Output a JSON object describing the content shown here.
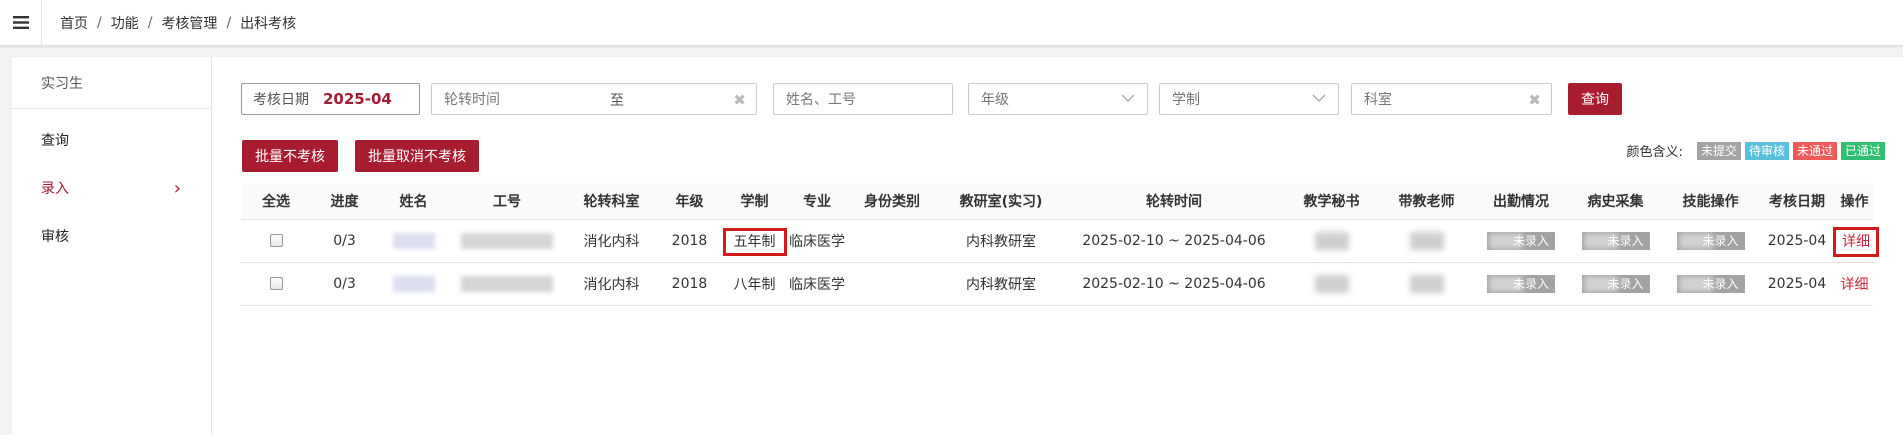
{
  "breadcrumb": [
    "首页",
    "功能",
    "考核管理",
    "出科考核"
  ],
  "sidebar": {
    "header": "实习生",
    "items": [
      {
        "label": "查询",
        "active": false
      },
      {
        "label": "录入",
        "active": true,
        "arrow": "›"
      },
      {
        "label": "审核",
        "active": false
      }
    ]
  },
  "filters": {
    "exam_date_label": "考核日期",
    "exam_date_value": "2025-04",
    "rotation_time_placeholder": "轮转时间",
    "rotation_to": "至",
    "name_placeholder": "姓名、工号",
    "grade_placeholder": "年级",
    "system_placeholder": "学制",
    "dept_placeholder": "科室",
    "clear_symbol": "✖",
    "query_label": "查询"
  },
  "actions": {
    "batch_no_exam": "批量不考核",
    "batch_cancel_no_exam": "批量取消不考核"
  },
  "legend": {
    "label": "颜色含义:",
    "tags": [
      {
        "text": "未提交",
        "color": "#a3a3a3"
      },
      {
        "text": "待审核",
        "color": "#5bc0de"
      },
      {
        "text": "未通过",
        "color": "#ee5a5a"
      },
      {
        "text": "已通过",
        "color": "#2fbf71"
      }
    ]
  },
  "table": {
    "headers": [
      "全选",
      "进度",
      "姓名",
      "工号",
      "轮转科室",
      "年级",
      "学制",
      "专业",
      "身份类别",
      "教研室(实习)",
      "轮转时间",
      "教学秘书",
      "带教老师",
      "出勤情况",
      "病史采集",
      "技能操作",
      "考核日期",
      "操作"
    ],
    "rows": [
      {
        "progress": "0/3",
        "dept": "消化内科",
        "grade": "2018",
        "system": "五年制",
        "major": "临床医学",
        "identity": "",
        "office": "内科教研室",
        "rotation": "2025-02-10 ~ 2025-04-06",
        "attendance": "未录入",
        "history": "未录入",
        "skill": "未录入",
        "exam_date": "2025-04",
        "action": "详细"
      },
      {
        "progress": "0/3",
        "dept": "消化内科",
        "grade": "2018",
        "system": "八年制",
        "major": "临床医学",
        "identity": "",
        "office": "内科教研室",
        "rotation": "2025-02-10 ~ 2025-04-06",
        "attendance": "未录入",
        "history": "未录入",
        "skill": "未录入",
        "exam_date": "2025-04",
        "action": "详细"
      }
    ]
  },
  "colors": {
    "accent": "#a81c30",
    "link": "#c62a3c",
    "highlight": "#d11b1b",
    "status_gray": "#a3a3a3"
  }
}
